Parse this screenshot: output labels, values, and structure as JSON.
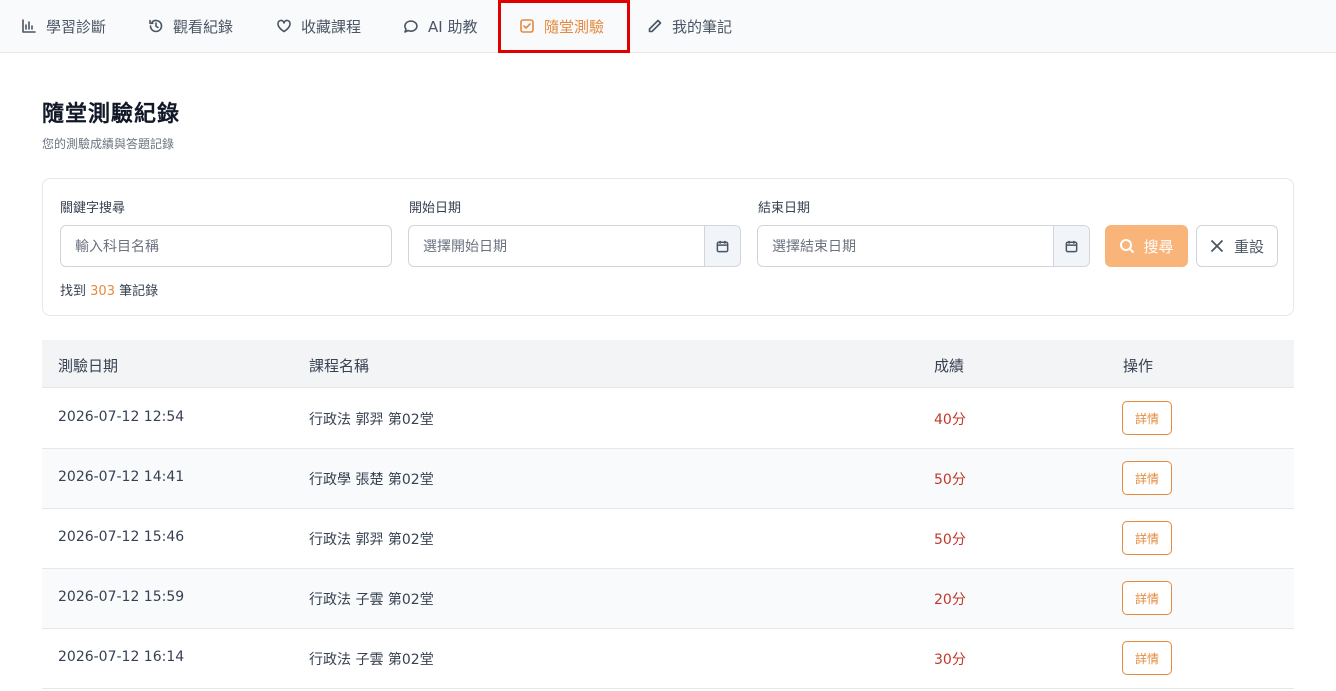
{
  "nav": {
    "tabs": [
      {
        "label": "學習診斷",
        "icon": "bar-chart-icon",
        "active": false
      },
      {
        "label": "觀看紀錄",
        "icon": "history-icon",
        "active": false
      },
      {
        "label": "收藏課程",
        "icon": "heart-icon",
        "active": false
      },
      {
        "label": "AI 助教",
        "icon": "chat-bubbles-icon",
        "active": false
      },
      {
        "label": "隨堂測驗",
        "icon": "checkbox-icon",
        "active": true
      },
      {
        "label": "我的筆記",
        "icon": "pencil-icon",
        "active": false
      }
    ],
    "active_color": "#e58a3c",
    "highlight_color": "#e00000"
  },
  "page": {
    "title": "隨堂測驗紀錄",
    "subtitle": "您的測驗成績與答題記錄"
  },
  "filter": {
    "keyword_label": "關鍵字搜尋",
    "keyword_placeholder": "輸入科目名稱",
    "start_label": "開始日期",
    "start_placeholder": "選擇開始日期",
    "end_label": "結束日期",
    "end_placeholder": "選擇結束日期",
    "search_label": "搜尋",
    "reset_label": "重設",
    "found_prefix": "找到",
    "found_count": "303",
    "found_suffix": "筆記錄"
  },
  "table": {
    "headers": [
      "測驗日期",
      "課程名稱",
      "成績",
      "操作"
    ],
    "rows": [
      {
        "date": "2026-07-12 12:54",
        "course": "行政法 郭羿 第02堂",
        "score": "40分",
        "action": "詳情"
      },
      {
        "date": "2026-07-12 14:41",
        "course": "行政學 張楚 第02堂",
        "score": "50分",
        "action": "詳情"
      },
      {
        "date": "2026-07-12 15:46",
        "course": "行政法 郭羿 第02堂",
        "score": "50分",
        "action": "詳情"
      },
      {
        "date": "2026-07-12 15:59",
        "course": "行政法 子雲 第02堂",
        "score": "20分",
        "action": "詳情"
      },
      {
        "date": "2026-07-12 16:14",
        "course": "行政法 子雲 第02堂",
        "score": "30分",
        "action": "詳情"
      }
    ]
  }
}
